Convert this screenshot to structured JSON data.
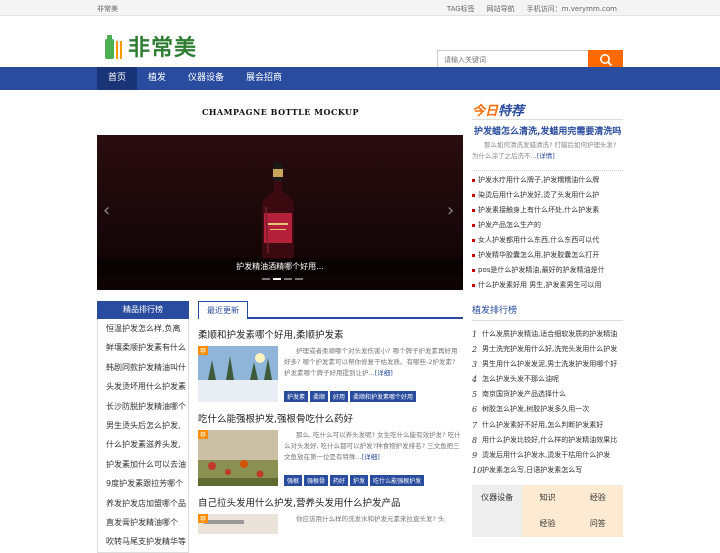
{
  "topbar": {
    "site_name": "非常美",
    "links": [
      "TAG标签",
      "网站导航",
      "手机访问：m.verymm.com"
    ]
  },
  "header": {
    "logo_text": "非常美",
    "search_placeholder": "请输入关键词"
  },
  "nav": {
    "items": [
      "首页",
      "植发",
      "仪器设备",
      "展会招商"
    ]
  },
  "slider": {
    "heading": "CHAMPAGNE BOTTLE MOCKUP",
    "caption": "护发精油酒精哪个好用..."
  },
  "rank": {
    "title": "精品排行榜",
    "items": [
      "恒温护发怎么样,负离",
      "鲜壤柔顺护发素有什么",
      "韩剧同款护发精油叫什",
      "头发烫坏用什么护发素",
      "长沙防脱护发精油哪个",
      "男生烫头后怎么护发,",
      "什么护发素滋养头发,",
      "护发素加什么可以去油",
      "9度护发素跟拉芳哪个",
      "养发护发店加盟哪个品",
      "直发膏护发精油哪个",
      "吹转马尾支护发精华等"
    ]
  },
  "latest": {
    "tab_label": "最近更新",
    "articles": [
      {
        "title": "柔顺和护发素哪个好用,柔顺护发素",
        "badge": "荐",
        "summary": "护理或者柔顺哪个对头发伤害小? 哪个牌子护发素再好用好多? 哪个护发素可以帮你修复干枯发质。有哪些-2护发素? 护发素哪个牌子好用提到让护...",
        "more": "[详细]",
        "tags": [
          "护发素",
          "柔顺",
          "好用",
          "柔顺和护发素哪个好用"
        ]
      },
      {
        "title": "吃什么能强根护发,强根骨吃什么药好",
        "badge": "荐",
        "summary": "那么, 吃什么可以养头发呢? 女生吃什么能有效护发? 吃什么对头发好, 吃什么都可以护发?种食物护发排名? 三文鱼把三文鱼放在第一位是有特殊...",
        "more": "[详细]",
        "tags": [
          "强根",
          "强根骨",
          "药好",
          "护发",
          "吃什么能强根护发"
        ]
      },
      {
        "title": "自己拉头发用什么护发,营养头发用什么护发产品",
        "badge": "荐",
        "summary": "你应该用什么样的洗发水和护发元素来拉直头发? 头",
        "more": "",
        "tags": []
      }
    ]
  },
  "right": {
    "today_part1": "今日",
    "today_part2": "特荐",
    "hot_title": "护发蜡怎么清洗,发蜡用完需要清洗吗",
    "hot_desc": "那么如何清洗发蜡清洗? 打蜡后如何护理头发? 为什么涂了之后洗不...",
    "hot_more": "[详情]",
    "hot_list": [
      "护发水疗用什么牌子,护发糯糯油什么牌",
      "染烫后用什么护发好,烫了头发用什么护",
      "护发素接触身上有什么坏处,什么护发素",
      "护发产品怎么生产的",
      "女人护发都用什么东西,什么东西可以代",
      "护发精华胶囊怎么用,护发胶囊怎么打开",
      "pos是什么护发精油,最好的护发精油是什",
      "什么护发素好用 男生,护发素男生可以用"
    ],
    "section_title": "植发排行榜",
    "num_list": [
      "什么发质护发精油,适合细软发质的护发精油",
      "男士洗完护发用什么好,洗完头发用什么护发",
      "男生用什么护发发泥,男士洗发护发用哪个好",
      "怎么护发头发不那么油呢",
      "南京国货护发产品选择什么",
      "树胶怎么护发,树胶护发多久用一次",
      "什么护发素好不好用,怎么判断护发素好",
      "用什么护发比较好,什么样的护发精油效果比",
      "烫发后用什么护发水,烫发干枯用什么护发",
      "护发素怎么写,日语护发素怎么写"
    ],
    "grid": [
      [
        "仪器设备",
        "知识",
        "经验"
      ],
      [
        "",
        "经验",
        "问答"
      ]
    ]
  }
}
